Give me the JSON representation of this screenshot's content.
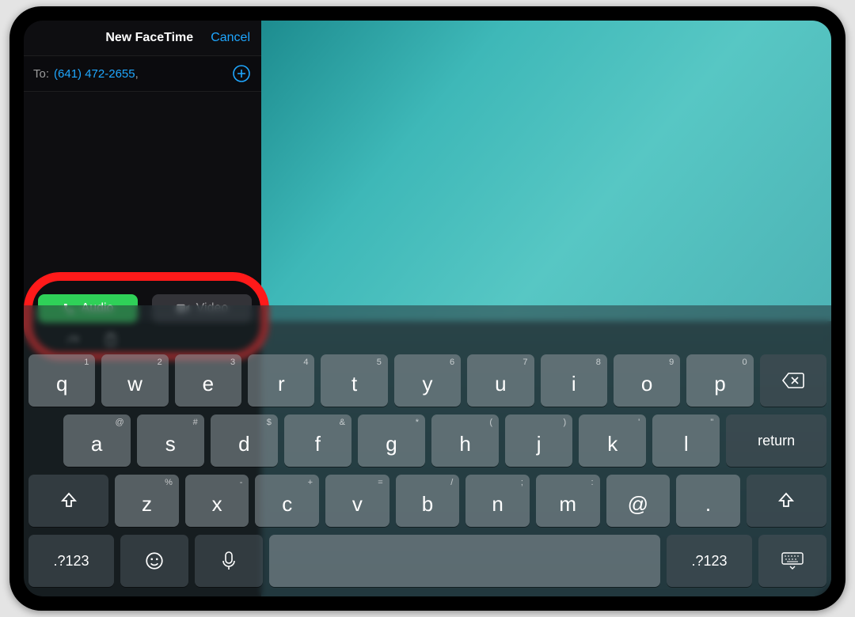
{
  "header": {
    "title": "New FaceTime",
    "cancel": "Cancel"
  },
  "to": {
    "label": "To:",
    "number": "(641) 472-2655",
    "comma": ","
  },
  "call": {
    "audio": "Audio",
    "video": "Video"
  },
  "keyboard": {
    "row1": [
      {
        "hint": "1",
        "main": "q"
      },
      {
        "hint": "2",
        "main": "w"
      },
      {
        "hint": "3",
        "main": "e"
      },
      {
        "hint": "4",
        "main": "r"
      },
      {
        "hint": "5",
        "main": "t"
      },
      {
        "hint": "6",
        "main": "y"
      },
      {
        "hint": "7",
        "main": "u"
      },
      {
        "hint": "8",
        "main": "i"
      },
      {
        "hint": "9",
        "main": "o"
      },
      {
        "hint": "0",
        "main": "p"
      }
    ],
    "row2": [
      {
        "hint": "@",
        "main": "a"
      },
      {
        "hint": "#",
        "main": "s"
      },
      {
        "hint": "$",
        "main": "d"
      },
      {
        "hint": "&",
        "main": "f"
      },
      {
        "hint": "*",
        "main": "g"
      },
      {
        "hint": "(",
        "main": "h"
      },
      {
        "hint": ")",
        "main": "j"
      },
      {
        "hint": "'",
        "main": "k"
      },
      {
        "hint": "\"",
        "main": "l"
      }
    ],
    "row3": [
      {
        "hint": "%",
        "main": "z"
      },
      {
        "hint": "-",
        "main": "x"
      },
      {
        "hint": "+",
        "main": "c"
      },
      {
        "hint": "=",
        "main": "v"
      },
      {
        "hint": "/",
        "main": "b"
      },
      {
        "hint": ";",
        "main": "n"
      },
      {
        "hint": ":",
        "main": "m"
      },
      {
        "hint": "",
        "main": "@"
      },
      {
        "hint": "",
        "main": "."
      }
    ],
    "return": "return",
    "mode": ".?123"
  }
}
